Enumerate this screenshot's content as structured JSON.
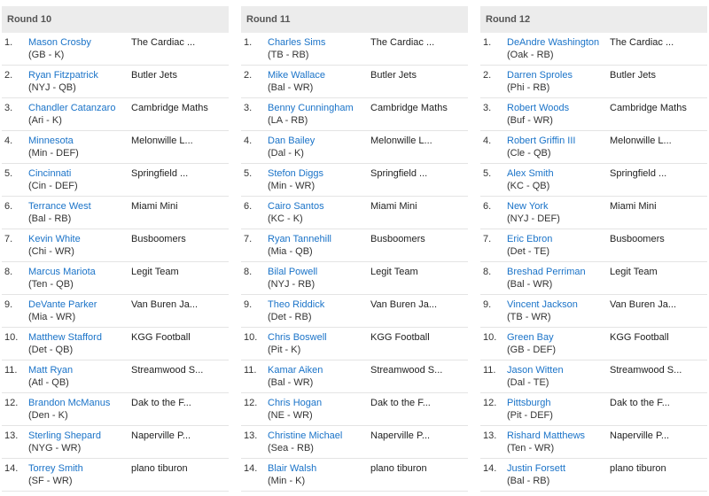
{
  "rounds": [
    {
      "title": "Round 10",
      "picks": [
        {
          "num": "1.",
          "player": "Mason Crosby",
          "meta": "(GB - K)",
          "team": "The Cardiac ..."
        },
        {
          "num": "2.",
          "player": "Ryan Fitzpatrick",
          "meta": "(NYJ - QB)",
          "team": "Butler Jets"
        },
        {
          "num": "3.",
          "player": "Chandler Catanzaro",
          "meta": "(Ari - K)",
          "team": "Cambridge Maths"
        },
        {
          "num": "4.",
          "player": "Minnesota",
          "meta": "(Min - DEF)",
          "team": "Melonwille L..."
        },
        {
          "num": "5.",
          "player": "Cincinnati",
          "meta": "(Cin - DEF)",
          "team": "Springfield ..."
        },
        {
          "num": "6.",
          "player": "Terrance West",
          "meta": "(Bal - RB)",
          "team": "Miami Mini"
        },
        {
          "num": "7.",
          "player": "Kevin White",
          "meta": "(Chi - WR)",
          "team": "Busboomers"
        },
        {
          "num": "8.",
          "player": "Marcus Mariota",
          "meta": "(Ten - QB)",
          "team": "Legit Team"
        },
        {
          "num": "9.",
          "player": "DeVante Parker",
          "meta": "(Mia - WR)",
          "team": "Van Buren Ja..."
        },
        {
          "num": "10.",
          "player": "Matthew Stafford",
          "meta": "(Det - QB)",
          "team": "KGG Football"
        },
        {
          "num": "11.",
          "player": "Matt Ryan",
          "meta": "(Atl - QB)",
          "team": "Streamwood S..."
        },
        {
          "num": "12.",
          "player": "Brandon McManus",
          "meta": "(Den - K)",
          "team": "Dak to the F..."
        },
        {
          "num": "13.",
          "player": "Sterling Shepard",
          "meta": "(NYG - WR)",
          "team": "Naperville P..."
        },
        {
          "num": "14.",
          "player": "Torrey Smith",
          "meta": "(SF - WR)",
          "team": "plano tiburon"
        }
      ]
    },
    {
      "title": "Round 11",
      "picks": [
        {
          "num": "1.",
          "player": "Charles Sims",
          "meta": "(TB - RB)",
          "team": "The Cardiac ..."
        },
        {
          "num": "2.",
          "player": "Mike Wallace",
          "meta": "(Bal - WR)",
          "team": "Butler Jets"
        },
        {
          "num": "3.",
          "player": "Benny Cunningham",
          "meta": "(LA - RB)",
          "team": "Cambridge Maths"
        },
        {
          "num": "4.",
          "player": "Dan Bailey",
          "meta": "(Dal - K)",
          "team": "Melonwille L..."
        },
        {
          "num": "5.",
          "player": "Stefon Diggs",
          "meta": "(Min - WR)",
          "team": "Springfield ..."
        },
        {
          "num": "6.",
          "player": "Cairo Santos",
          "meta": "(KC - K)",
          "team": "Miami Mini"
        },
        {
          "num": "7.",
          "player": "Ryan Tannehill",
          "meta": "(Mia - QB)",
          "team": "Busboomers"
        },
        {
          "num": "8.",
          "player": "Bilal Powell",
          "meta": "(NYJ - RB)",
          "team": "Legit Team"
        },
        {
          "num": "9.",
          "player": "Theo Riddick",
          "meta": "(Det - RB)",
          "team": "Van Buren Ja..."
        },
        {
          "num": "10.",
          "player": "Chris Boswell",
          "meta": "(Pit - K)",
          "team": "KGG Football"
        },
        {
          "num": "11.",
          "player": "Kamar Aiken",
          "meta": "(Bal - WR)",
          "team": "Streamwood S..."
        },
        {
          "num": "12.",
          "player": "Chris Hogan",
          "meta": "(NE - WR)",
          "team": "Dak to the F..."
        },
        {
          "num": "13.",
          "player": "Christine Michael",
          "meta": "(Sea - RB)",
          "team": "Naperville P..."
        },
        {
          "num": "14.",
          "player": "Blair Walsh",
          "meta": "(Min - K)",
          "team": "plano tiburon"
        }
      ]
    },
    {
      "title": "Round 12",
      "picks": [
        {
          "num": "1.",
          "player": "DeAndre Washington",
          "meta": "(Oak - RB)",
          "team": "The Cardiac ..."
        },
        {
          "num": "2.",
          "player": "Darren Sproles",
          "meta": "(Phi - RB)",
          "team": "Butler Jets"
        },
        {
          "num": "3.",
          "player": "Robert Woods",
          "meta": "(Buf - WR)",
          "team": "Cambridge Maths"
        },
        {
          "num": "4.",
          "player": "Robert Griffin III",
          "meta": "(Cle - QB)",
          "team": "Melonwille L..."
        },
        {
          "num": "5.",
          "player": "Alex Smith",
          "meta": "(KC - QB)",
          "team": "Springfield ..."
        },
        {
          "num": "6.",
          "player": "New York",
          "meta": "(NYJ - DEF)",
          "team": "Miami Mini"
        },
        {
          "num": "7.",
          "player": "Eric Ebron",
          "meta": "(Det - TE)",
          "team": "Busboomers"
        },
        {
          "num": "8.",
          "player": "Breshad Perriman",
          "meta": "(Bal - WR)",
          "team": "Legit Team"
        },
        {
          "num": "9.",
          "player": "Vincent Jackson",
          "meta": "(TB - WR)",
          "team": "Van Buren Ja..."
        },
        {
          "num": "10.",
          "player": "Green Bay",
          "meta": "(GB - DEF)",
          "team": "KGG Football"
        },
        {
          "num": "11.",
          "player": "Jason Witten",
          "meta": "(Dal - TE)",
          "team": "Streamwood S..."
        },
        {
          "num": "12.",
          "player": "Pittsburgh",
          "meta": "(Pit - DEF)",
          "team": "Dak to the F..."
        },
        {
          "num": "13.",
          "player": "Rishard Matthews",
          "meta": "(Ten - WR)",
          "team": "Naperville P..."
        },
        {
          "num": "14.",
          "player": "Justin Forsett",
          "meta": "(Bal - RB)",
          "team": "plano tiburon"
        }
      ]
    }
  ]
}
